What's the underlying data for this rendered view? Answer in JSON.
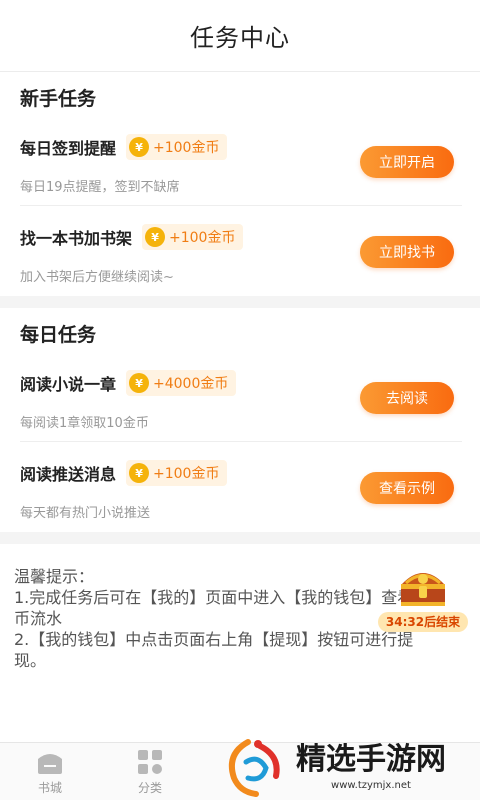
{
  "header": {
    "title": "任务中心"
  },
  "newbie": {
    "title": "新手任务",
    "tasks": [
      {
        "name": "每日签到提醒",
        "coin_symbol": "¥",
        "reward": "+100金币",
        "desc": "每日19点提醒，签到不缺席",
        "button": "立即开启"
      },
      {
        "name": "找一本书加书架",
        "coin_symbol": "¥",
        "reward": "+100金币",
        "desc": "加入书架后方便继续阅读~",
        "button": "立即找书"
      }
    ]
  },
  "daily": {
    "title": "每日任务",
    "tasks": [
      {
        "name": "阅读小说一章",
        "coin_symbol": "¥",
        "reward": "+4000金币",
        "desc": "每阅读1章领取10金币",
        "button": "去阅读"
      },
      {
        "name": "阅读推送消息",
        "coin_symbol": "¥",
        "reward": "+100金币",
        "desc": "每天都有热门小说推送",
        "button": "查看示例"
      }
    ]
  },
  "tips": {
    "line1": "温馨提示：",
    "line2": "1.完成任务后可在【我的】页面中进入【我的钱包】查看金",
    "line3": "币流水",
    "line4": "2.【我的钱包】中点击页面右上角【提现】按钮可进行提",
    "line5": "现。"
  },
  "treasure": {
    "timer": "34:32后结束"
  },
  "tabbar": {
    "tab1": "书城",
    "tab2": "分类"
  },
  "watermark": {
    "title": "精选手游网",
    "url": "www.tzymjx.net"
  },
  "colors": {
    "accent": "#f97b1e",
    "coin": "#f5b30b"
  }
}
